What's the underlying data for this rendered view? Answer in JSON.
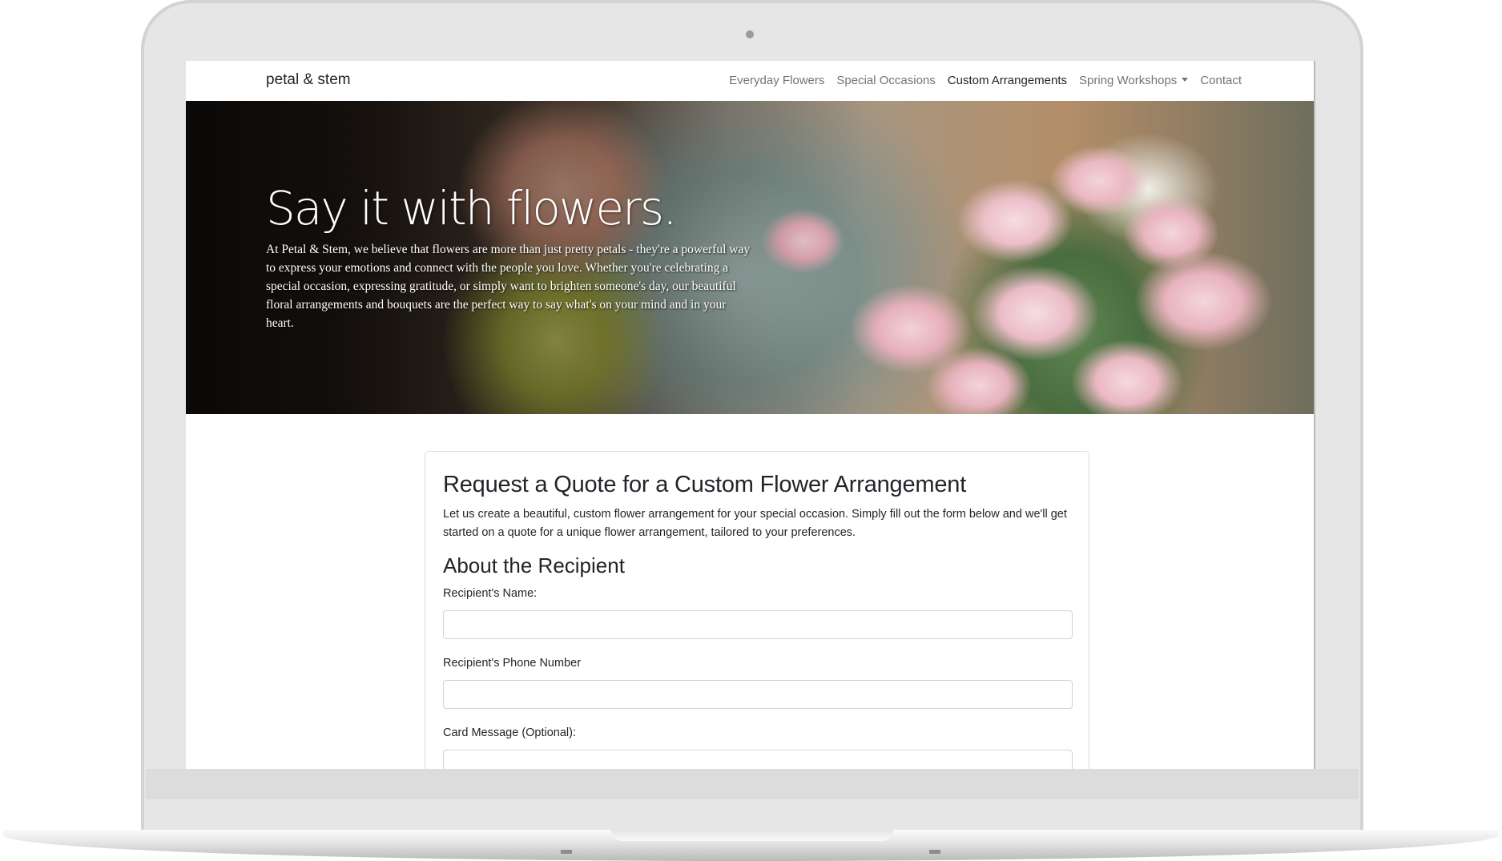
{
  "site": {
    "brand": "petal & stem"
  },
  "nav": {
    "items": [
      {
        "label": "Everyday Flowers",
        "active": false
      },
      {
        "label": "Special Occasions",
        "active": false
      },
      {
        "label": "Custom Arrangements",
        "active": true
      },
      {
        "label": "Spring Workshops",
        "active": false,
        "dropdown": true
      },
      {
        "label": "Contact",
        "active": false
      }
    ],
    "dropdown_icon": "caret-down-icon"
  },
  "hero": {
    "title": "Say it with flowers.",
    "text": "At Petal & Stem, we believe that flowers are more than just pretty petals - they're a powerful way to express your emotions and connect with the people you love. Whether you're celebrating a special occasion, expressing gratitude, or simply want to brighten someone's day, our beautiful floral arrangements and bouquets are the perfect way to say what's on your mind and in your heart."
  },
  "form": {
    "title": "Request a Quote for a Custom Flower Arrangement",
    "intro": "Let us create a beautiful, custom flower arrangement for your special occasion. Simply fill out the form below and we'll get started on a quote for a unique flower arrangement, tailored to your preferences.",
    "section_title": "About the Recipient",
    "fields": [
      {
        "label": "Recipient's Name:",
        "value": "",
        "placeholder": ""
      },
      {
        "label": "Recipient's Phone Number",
        "value": "",
        "placeholder": ""
      },
      {
        "label": "Card Message (Optional):",
        "value": "",
        "placeholder": ""
      }
    ]
  },
  "colors": {
    "text_primary": "#212529",
    "nav_muted": "#6c757d",
    "card_border": "#cfe3e4",
    "input_border": "#ced4da"
  }
}
